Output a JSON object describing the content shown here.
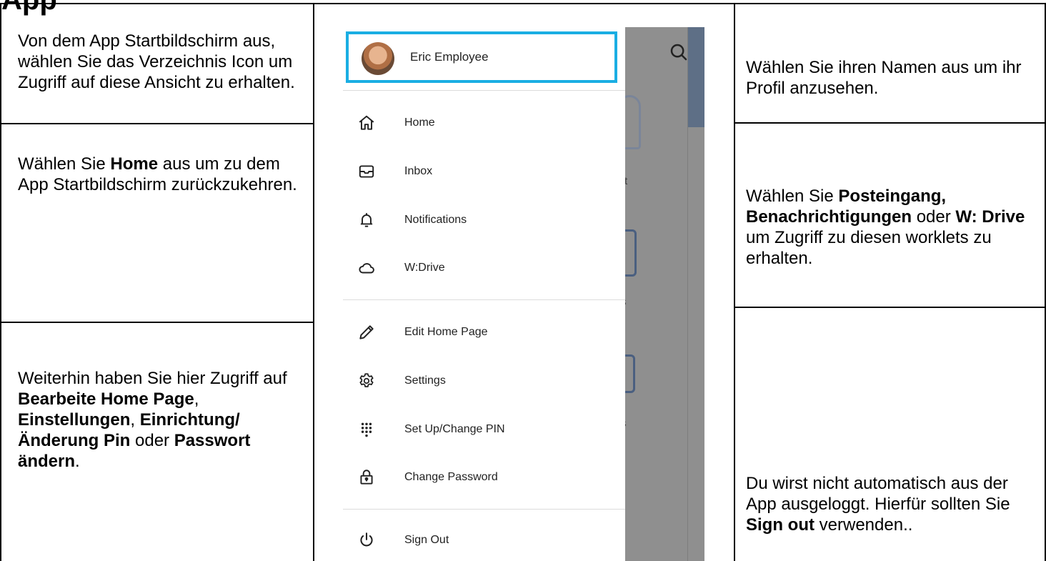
{
  "doc": {
    "left_cells": [
      {
        "parts": [
          {
            "t": "Von dem App Startbildschirm aus, wählen Sie das Verzeichnis Icon um Zugriff auf diese Ansicht zu erhalten.",
            "b": false
          }
        ]
      },
      {
        "parts": [
          {
            "t": "Wählen Sie ",
            "b": false
          },
          {
            "t": "Home",
            "b": true
          },
          {
            "t": " aus um zu dem App Startbildschirm zurückzukehren.",
            "b": false
          }
        ]
      },
      {
        "parts": [
          {
            "t": "Weiterhin haben Sie hier Zugriff auf ",
            "b": false
          },
          {
            "t": "Bearbeite Home Page",
            "b": true
          },
          {
            "t": ", ",
            "b": false
          },
          {
            "t": "Einstellungen",
            "b": true
          },
          {
            "t": ", ",
            "b": false
          },
          {
            "t": "Einrichtung/Änderung Pin",
            "b": true
          },
          {
            "t": " oder  ",
            "b": false
          },
          {
            "t": "Passwort ändern",
            "b": true
          },
          {
            "t": ".",
            "b": false
          }
        ]
      }
    ],
    "right_cells": [
      {
        "parts": [
          {
            "t": "Wählen Sie ihren Namen aus um ihr Profil anzusehen.",
            "b": false
          }
        ]
      },
      {
        "parts": [
          {
            "t": "Wählen Sie ",
            "b": false
          },
          {
            "t": "Posteingang, Benachrichtigungen",
            "b": true
          },
          {
            "t": " oder ",
            "b": false
          },
          {
            "t": "W: Drive",
            "b": true
          },
          {
            "t": " um Zugriff zu diesen worklets zu erhalten.",
            "b": false
          }
        ]
      },
      {
        "parts": [
          {
            "t": "Du wirst nicht automatisch aus der App ausgeloggt. Hierfür sollten Sie ",
            "b": false
          },
          {
            "t": "Sign out",
            "b": true
          },
          {
            "t": " verwenden..",
            "b": false
          }
        ]
      }
    ]
  },
  "drawer": {
    "user_name": "Eric Employee",
    "items": [
      {
        "label": "Home",
        "icon": "home-icon"
      },
      {
        "label": "Inbox",
        "icon": "inbox-icon"
      },
      {
        "label": "Notifications",
        "icon": "bell-icon"
      },
      {
        "label": "W:Drive",
        "icon": "cloud-icon"
      },
      {
        "label": "Edit Home Page",
        "icon": "pencil-icon"
      },
      {
        "label": "Settings",
        "icon": "gear-icon"
      },
      {
        "label": "Set Up/Change PIN",
        "icon": "keypad-icon"
      },
      {
        "label": "Change Password",
        "icon": "lock-icon"
      },
      {
        "label": "Sign Out",
        "icon": "power-icon"
      }
    ]
  },
  "background_fragments": [
    "rt",
    "s",
    "s"
  ],
  "colors": {
    "highlight": "#1aaee3",
    "overlay": "#8e8e8e",
    "accent": "#4a5f80"
  }
}
